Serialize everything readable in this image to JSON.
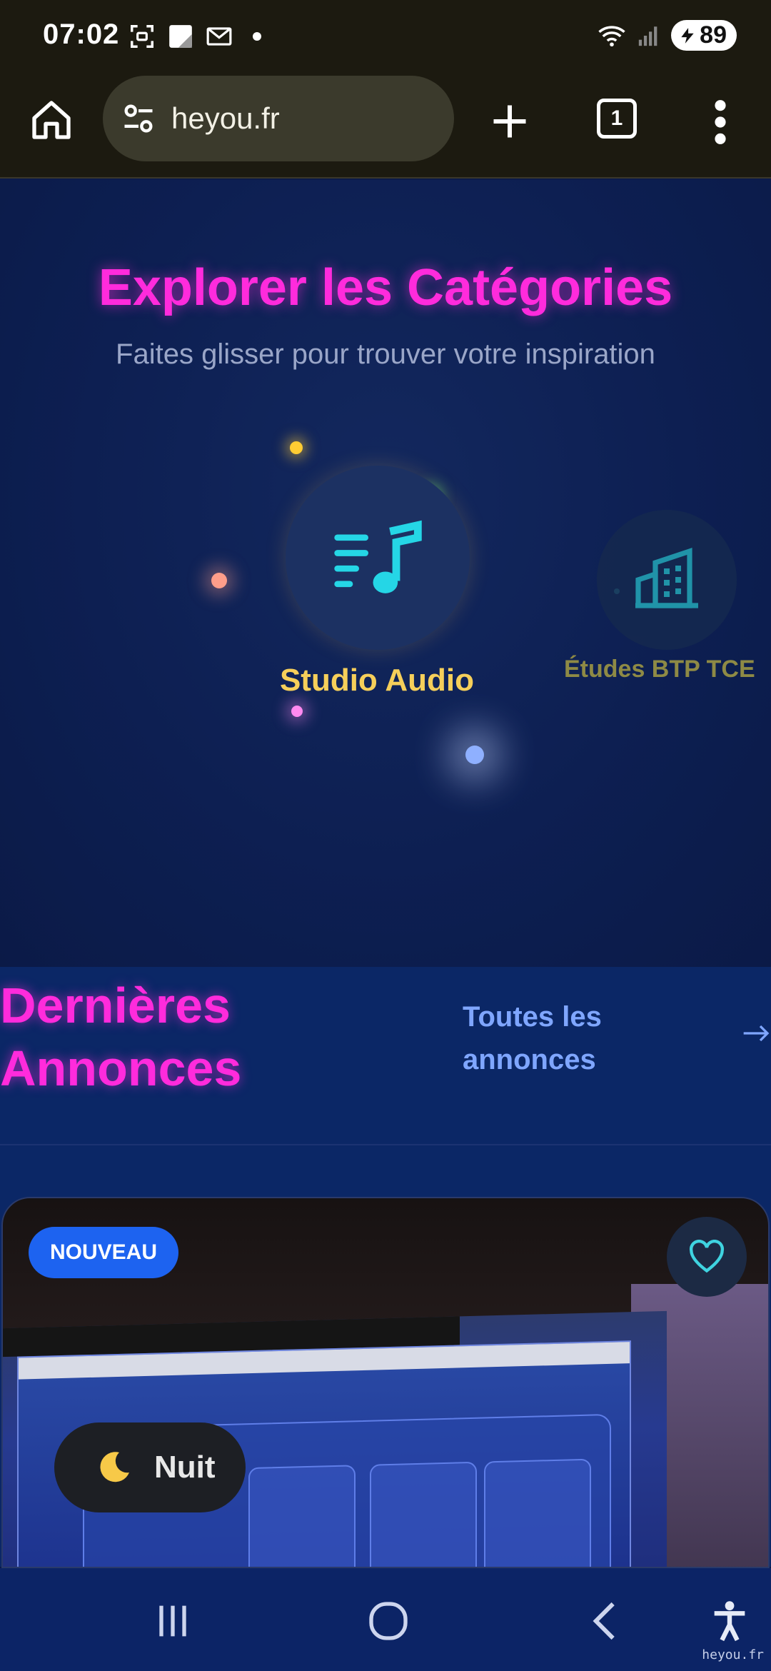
{
  "status_bar": {
    "time": "07:02",
    "battery": "89",
    "icons": [
      "screenshot-icon",
      "gallery-icon",
      "mail-icon",
      "notification-dot",
      "wifi-icon",
      "signal-icon",
      "battery-charging-icon"
    ]
  },
  "browser": {
    "url": "heyou.fr",
    "tab_count": "1",
    "icons": [
      "home-icon",
      "site-settings-icon",
      "plus-icon",
      "tabs-icon",
      "more-vert-icon"
    ]
  },
  "hero": {
    "title": "Explorer les Catégories",
    "subtitle": "Faites glisser pour trouver votre inspiration",
    "categories": [
      {
        "label": "Studio Audio",
        "icon": "music-note-icon"
      },
      {
        "label": "Études BTP TCE",
        "icon": "building-icon"
      }
    ]
  },
  "annonces": {
    "title_line1": "Dernières",
    "title_line2": "Annonces",
    "link_line1": "Toutes les",
    "link_line2": "annonces"
  },
  "card": {
    "badge": "NOUVEAU",
    "favorite_icon": "heart-icon"
  },
  "night_toggle": {
    "label": "Nuit",
    "icon": "moon-icon"
  },
  "nav_bar": {
    "icons": [
      "recents-icon",
      "home-circle-icon",
      "back-icon",
      "accessibility-icon"
    ],
    "watermark": "heyou.fr"
  },
  "colors": {
    "accent_magenta": "#ff2bdc",
    "accent_gold": "#f6cf5a",
    "link_blue": "#7fa6ff",
    "badge_blue": "#1d63f0"
  }
}
